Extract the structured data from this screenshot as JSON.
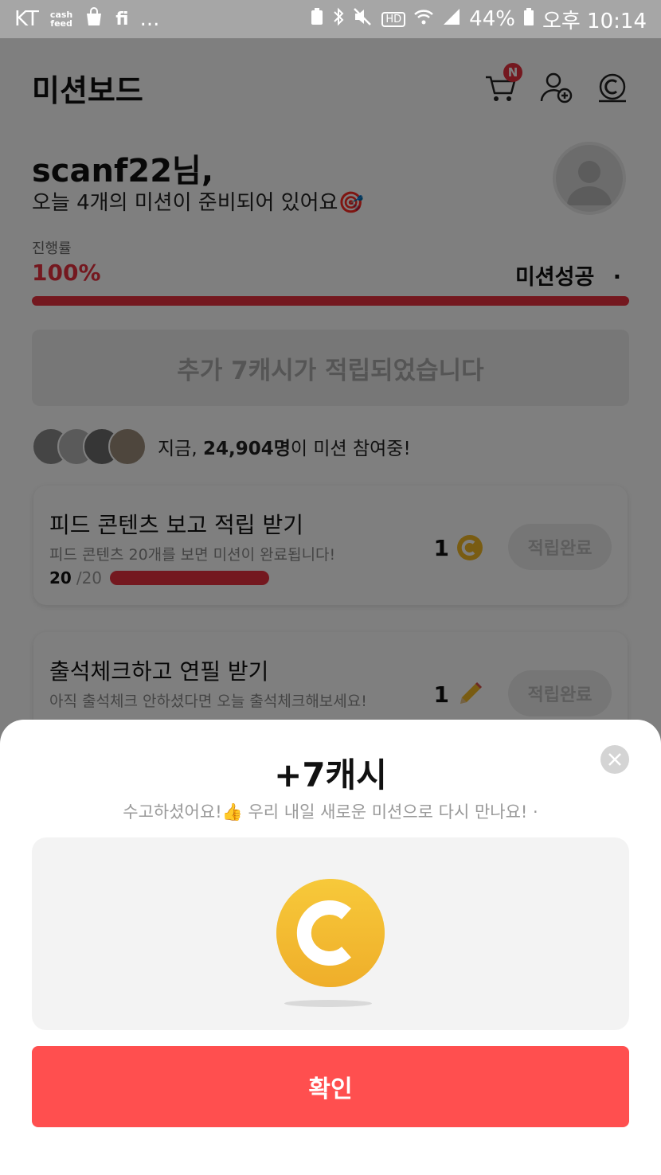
{
  "status_bar": {
    "carrier": "KT",
    "cashfeed_line1": "cash",
    "cashfeed_line2": "feed",
    "fi_label": "fi",
    "more_label": "...",
    "hd_label": "HD",
    "battery": "44%",
    "time": "오후 10:14"
  },
  "header": {
    "title": "미션보드",
    "cart_badge": "N"
  },
  "greeting": {
    "name": "scanf22님,",
    "message": "오늘 4개의 미션이 준비되어 있어요🎯"
  },
  "progress": {
    "label": "진행률",
    "value_text": "100%",
    "fraction": 1.0,
    "status": "미션성공"
  },
  "banner": {
    "text": "추가 7캐시가 적립되었습니다"
  },
  "participants": {
    "prefix": "지금, ",
    "count": "24,904명",
    "suffix": "이 미션 참여중!"
  },
  "missions": [
    {
      "title": "피드 콘텐츠 보고 적립 받기",
      "description": "피드 콘텐츠 20개를 보면 미션이 완료됩니다!",
      "reward": "1",
      "reward_icon": "cash-coin-icon",
      "button": "적립완료",
      "progress_done": "20",
      "progress_total": "/20"
    },
    {
      "title": "출석체크하고 연필 받기",
      "description": "아직 출석체크 안하셨다면 오늘 출석체크해보세요!",
      "reward": "1",
      "reward_icon": "pencil-icon",
      "button": "적립완료"
    }
  ],
  "sheet": {
    "title": "+7캐시",
    "subtitle": "수고하셨어요!👍 우리 내일 새로운 미션으로 다시 만나요! ·",
    "confirm": "확인"
  },
  "colors": {
    "accent": "#e8313f",
    "confirm": "#ff4f4f",
    "coin": "#f2b924"
  }
}
